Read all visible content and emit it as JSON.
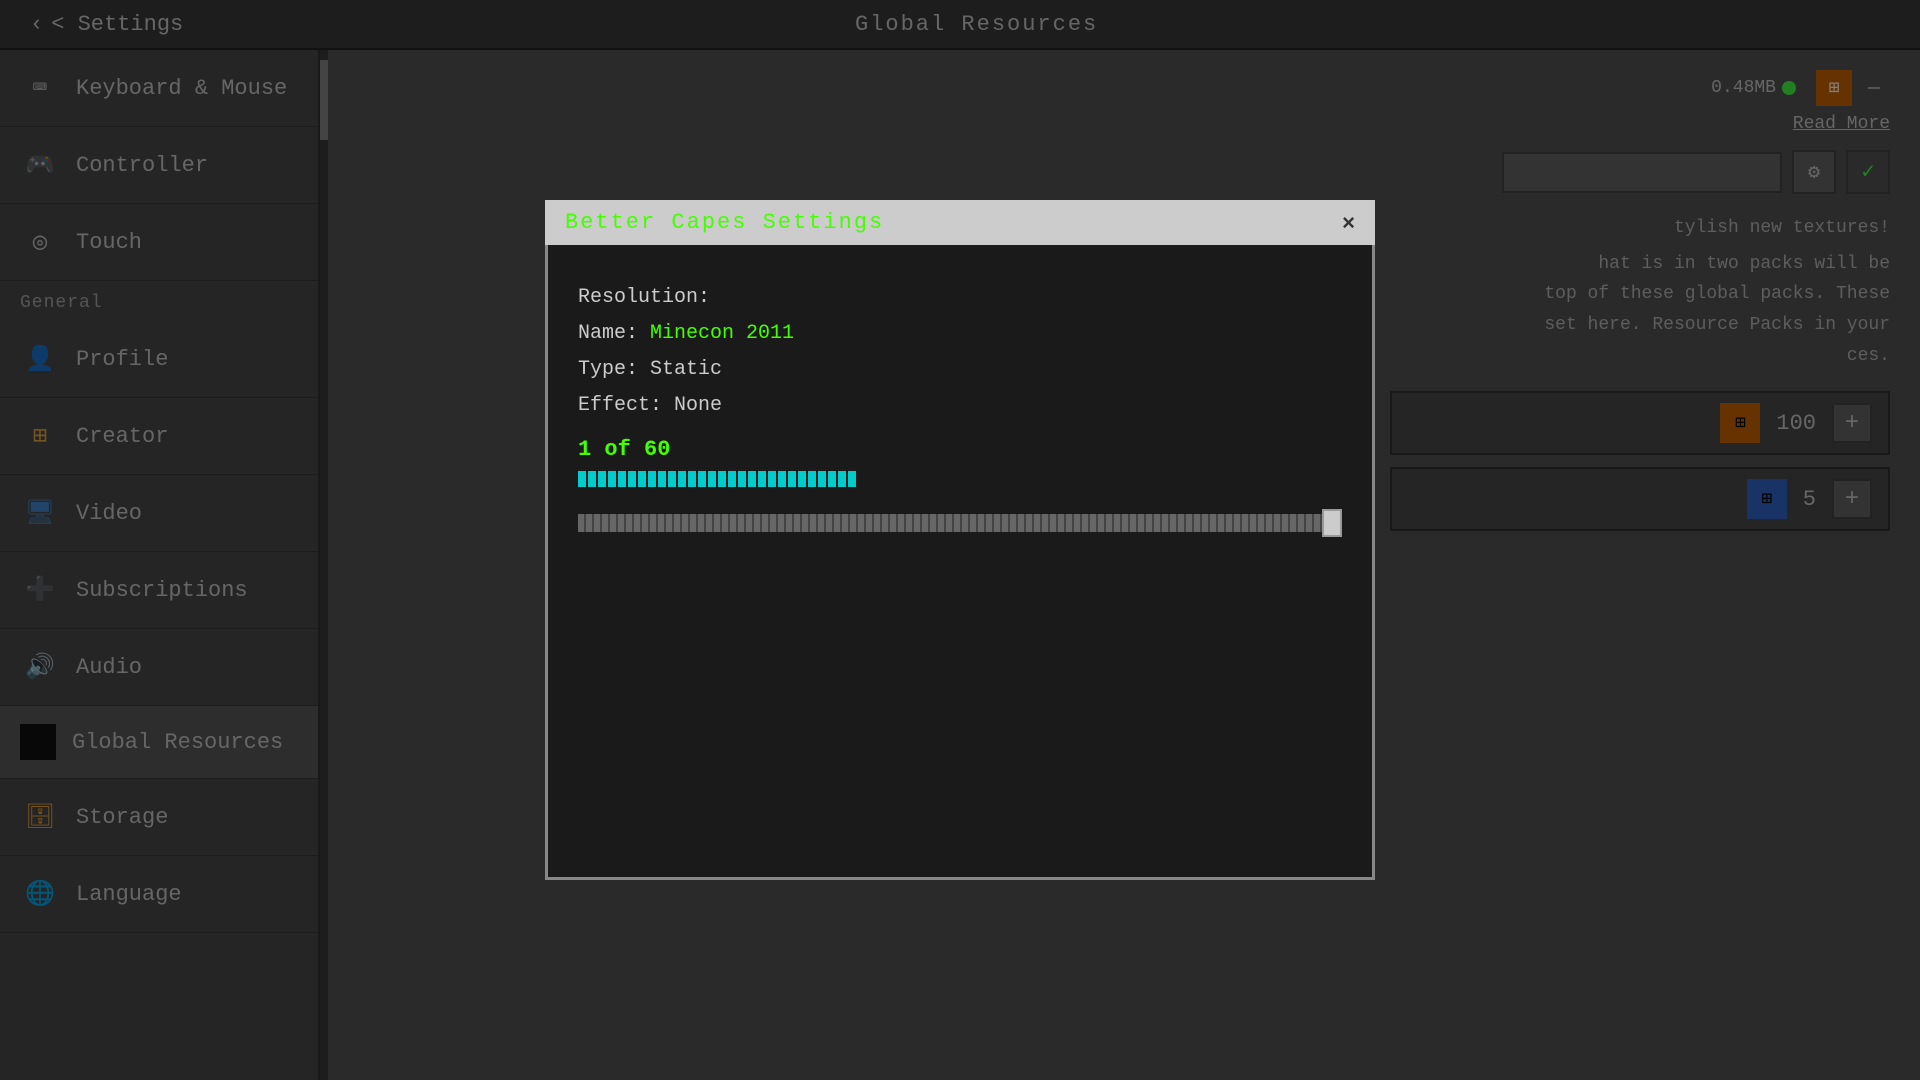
{
  "topbar": {
    "back_label": "< Settings",
    "title": "Global Resources"
  },
  "sidebar": {
    "sections": [
      {
        "items": [
          {
            "id": "keyboard-mouse",
            "label": "Keyboard & Mouse",
            "icon": "⌨"
          },
          {
            "id": "controller",
            "label": "Controller",
            "icon": "🎮"
          },
          {
            "id": "touch",
            "label": "Touch",
            "icon": "◎"
          }
        ]
      },
      {
        "section_label": "General",
        "items": [
          {
            "id": "profile",
            "label": "Profile",
            "icon": "👤"
          },
          {
            "id": "creator",
            "label": "Creator",
            "icon": "⊞"
          },
          {
            "id": "video",
            "label": "Video",
            "icon": "🖥"
          },
          {
            "id": "subscriptions",
            "label": "Subscriptions",
            "icon": "➕"
          },
          {
            "id": "audio",
            "label": "Audio",
            "icon": "🔊"
          },
          {
            "id": "global-resources",
            "label": "Global Resources",
            "icon": "■",
            "active": true
          },
          {
            "id": "storage",
            "label": "Storage",
            "icon": "🗄"
          },
          {
            "id": "language",
            "label": "Language",
            "icon": "🌐"
          }
        ]
      }
    ]
  },
  "right": {
    "memory": "0.48MB",
    "read_more": "Read More",
    "search_placeholder": "",
    "description_partial": "tylish new textures!",
    "description_full": "hat is in two packs will be\ntop of these global packs. These\nset here. Resource Packs in your\nces.",
    "packs": [
      {
        "icon": "🔲",
        "number": "100",
        "icon_color": "#cc6600"
      },
      {
        "icon": "🔲",
        "number": "5",
        "icon_color": "#3366cc"
      }
    ]
  },
  "modal": {
    "title": "Better Capes Settings",
    "close_label": "×",
    "lines": [
      {
        "label": "Resolution:",
        "value": "",
        "colored": false
      },
      {
        "label": "Name:",
        "value": "Minecon 2011",
        "colored": true
      },
      {
        "label": "Type:",
        "value": "Static",
        "colored": false
      },
      {
        "label": "Effect:",
        "value": "None",
        "colored": false
      }
    ],
    "counter": "1 of 60",
    "progress_filled": 28,
    "progress_total": 60,
    "slider_value": 95
  }
}
